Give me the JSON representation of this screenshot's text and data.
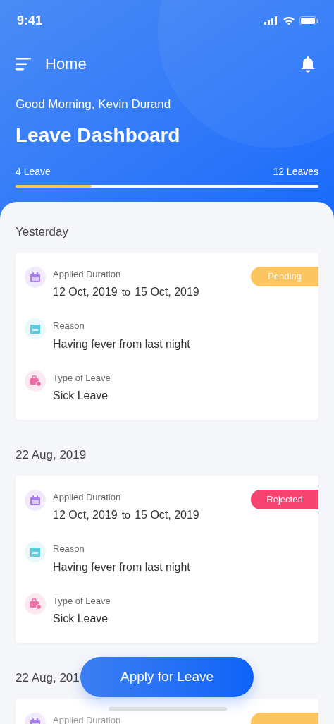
{
  "status_bar": {
    "time": "9:41"
  },
  "header": {
    "title": "Home",
    "greeting": "Good Morning, Kevin Durand",
    "heading": "Leave Dashboard",
    "progress": {
      "start_label": "4 Leave",
      "end_label": "12 Leaves",
      "level": 0.25
    }
  },
  "groups": [
    {
      "date": "Yesterday",
      "status": {
        "label": "Pending",
        "color": "#fcc55f"
      },
      "fields": [
        {
          "kind": "duration",
          "label": "Applied Duration",
          "from": "12 Oct, 2019",
          "joiner": "to",
          "to": "15 Oct, 2019"
        },
        {
          "kind": "reason",
          "label": "Reason",
          "value": "Having fever from last night"
        },
        {
          "kind": "type",
          "label": "Type of Leave",
          "value": "Sick Leave"
        }
      ]
    },
    {
      "date": "22 Aug, 2019",
      "status": {
        "label": "Rejected",
        "color": "#f7436f"
      },
      "fields": [
        {
          "kind": "duration",
          "label": "Applied Duration",
          "from": "12 Oct, 2019",
          "joiner": "to",
          "to": "15 Oct, 2019"
        },
        {
          "kind": "reason",
          "label": "Reason",
          "value": "Having fever from last night"
        },
        {
          "kind": "type",
          "label": "Type of Leave",
          "value": "Sick Leave"
        }
      ]
    },
    {
      "date": "22 Aug, 201",
      "status": {
        "color": "#fcc55f"
      },
      "fields": [
        {
          "kind": "duration",
          "label": "Applied Duration"
        }
      ]
    }
  ],
  "apply_button": "Apply for Leave"
}
